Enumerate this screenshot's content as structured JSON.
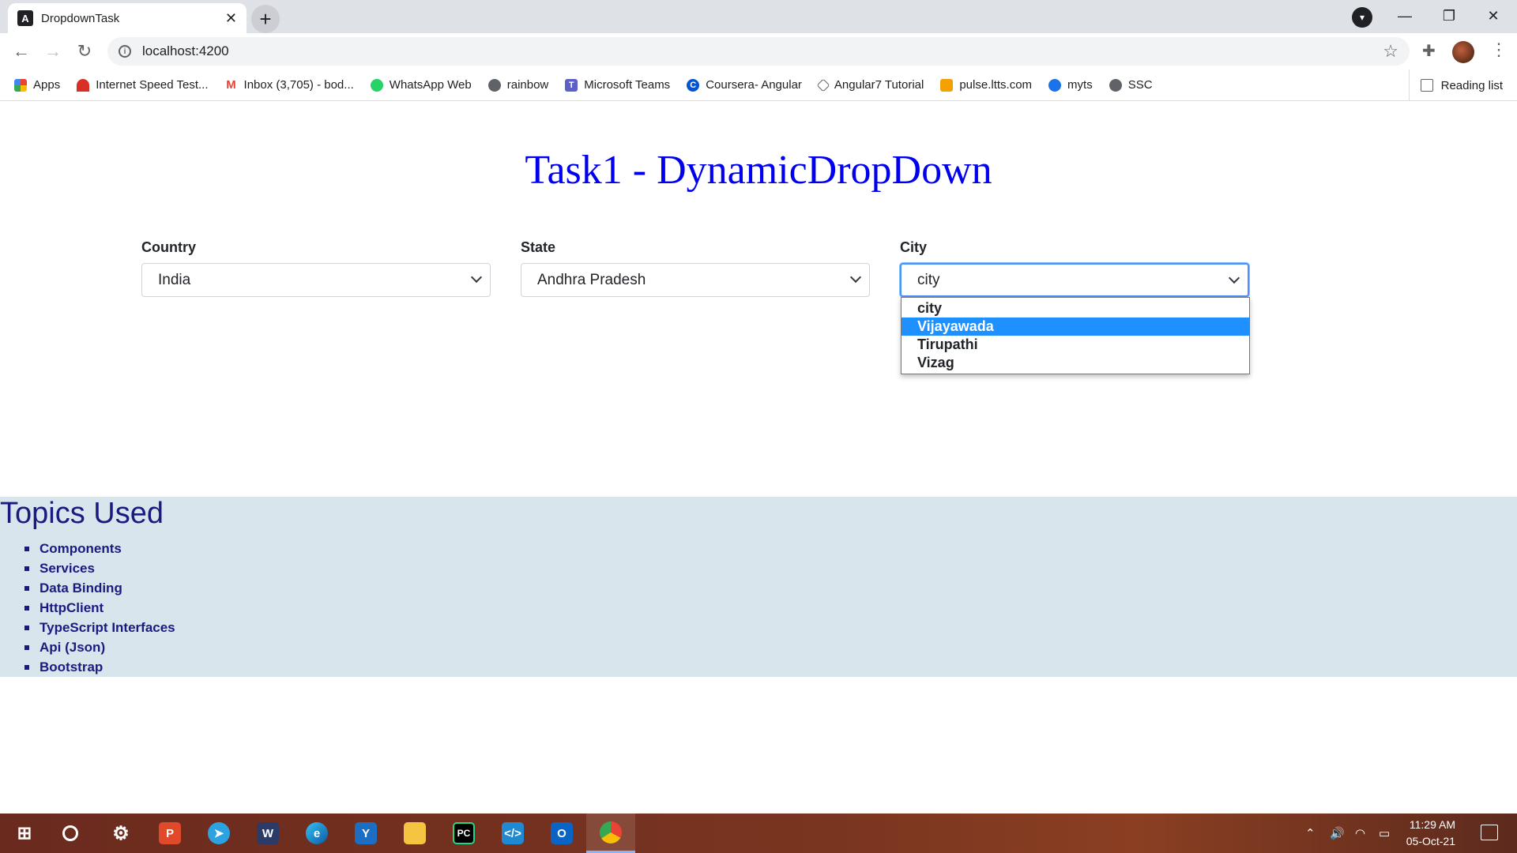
{
  "browser": {
    "tab_title": "DropdownTask",
    "tab_close": "✕",
    "new_tab": "+",
    "url": "localhost:4200",
    "bookmarks": [
      {
        "label": "Apps",
        "icon": "apps-grid-icon",
        "color": "#ea4335"
      },
      {
        "label": "Internet Speed Test...",
        "icon": "speedometer-icon",
        "color": "#d93025"
      },
      {
        "label": "Inbox (3,705) - bod...",
        "icon": "gmail-icon",
        "color": "#ea4335"
      },
      {
        "label": "WhatsApp Web",
        "icon": "whatsapp-icon",
        "color": "#25d366"
      },
      {
        "label": "rainbow",
        "icon": "globe-icon",
        "color": "#5f6368"
      },
      {
        "label": "Microsoft Teams",
        "icon": "teams-icon",
        "color": "#5b5fc7"
      },
      {
        "label": "Coursera- Angular",
        "icon": "coursera-icon",
        "color": "#0056d2"
      },
      {
        "label": "Angular7 Tutorial",
        "icon": "angular-diamond-icon",
        "color": "#5f6368"
      },
      {
        "label": "pulse.ltts.com",
        "icon": "pulse-icon",
        "color": "#f4a100"
      },
      {
        "label": "myts",
        "icon": "myts-icon",
        "color": "#1a73e8"
      },
      {
        "label": "SSC",
        "icon": "globe-icon",
        "color": "#5f6368"
      }
    ],
    "reading_list": "Reading list"
  },
  "page": {
    "heading": "Task1 - DynamicDropDown",
    "country": {
      "label": "Country",
      "value": "India"
    },
    "state": {
      "label": "State",
      "value": "Andhra Pradesh"
    },
    "city": {
      "label": "City",
      "value": "city",
      "options": [
        "city",
        "Vijayawada",
        "Tirupathi",
        "Vizag"
      ],
      "highlighted": "Vijayawada"
    },
    "topics": {
      "title": "Topics Used",
      "items": [
        "Components",
        "Services",
        "Data Binding",
        "HttpClient",
        "TypeScript Interfaces",
        "Api (Json)",
        "Bootstrap"
      ]
    },
    "colors": {
      "heading": "#0000ee",
      "topics_bg": "#d8e5ec",
      "topics_text": "#1a1a80",
      "option_highlight": "#1e90ff"
    }
  },
  "taskbar": {
    "apps": [
      "windows-start-icon",
      "cortana-search-icon",
      "settings-gear-icon",
      "p-app-icon",
      "telegram-icon",
      "teams-chat-icon",
      "edge-icon",
      "yammer-icon",
      "file-explorer-icon",
      "pycharm-icon",
      "vscode-icon",
      "outlook-icon",
      "chrome-icon"
    ],
    "time": "11:29 AM",
    "date": "05-Oct-21"
  }
}
